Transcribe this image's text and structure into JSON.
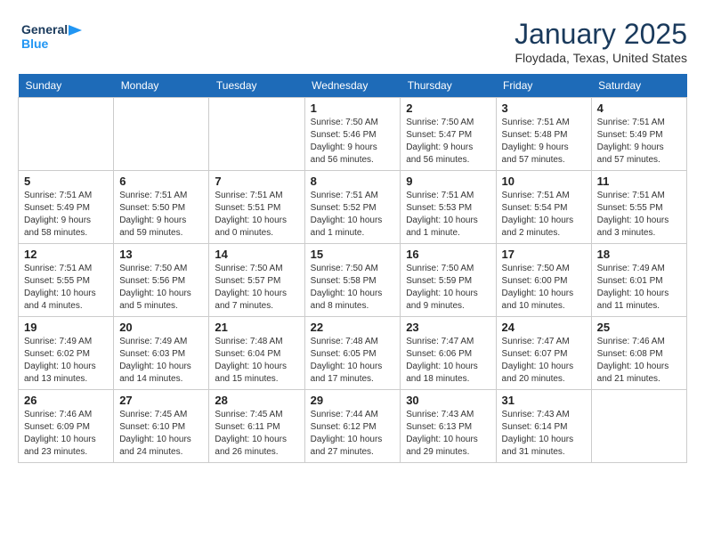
{
  "header": {
    "logo_line1": "General",
    "logo_line2": "Blue",
    "month": "January 2025",
    "location": "Floydada, Texas, United States"
  },
  "days_of_week": [
    "Sunday",
    "Monday",
    "Tuesday",
    "Wednesday",
    "Thursday",
    "Friday",
    "Saturday"
  ],
  "weeks": [
    [
      {
        "day": "",
        "info": ""
      },
      {
        "day": "",
        "info": ""
      },
      {
        "day": "",
        "info": ""
      },
      {
        "day": "1",
        "info": "Sunrise: 7:50 AM\nSunset: 5:46 PM\nDaylight: 9 hours\nand 56 minutes."
      },
      {
        "day": "2",
        "info": "Sunrise: 7:50 AM\nSunset: 5:47 PM\nDaylight: 9 hours\nand 56 minutes."
      },
      {
        "day": "3",
        "info": "Sunrise: 7:51 AM\nSunset: 5:48 PM\nDaylight: 9 hours\nand 57 minutes."
      },
      {
        "day": "4",
        "info": "Sunrise: 7:51 AM\nSunset: 5:49 PM\nDaylight: 9 hours\nand 57 minutes."
      }
    ],
    [
      {
        "day": "5",
        "info": "Sunrise: 7:51 AM\nSunset: 5:49 PM\nDaylight: 9 hours\nand 58 minutes."
      },
      {
        "day": "6",
        "info": "Sunrise: 7:51 AM\nSunset: 5:50 PM\nDaylight: 9 hours\nand 59 minutes."
      },
      {
        "day": "7",
        "info": "Sunrise: 7:51 AM\nSunset: 5:51 PM\nDaylight: 10 hours\nand 0 minutes."
      },
      {
        "day": "8",
        "info": "Sunrise: 7:51 AM\nSunset: 5:52 PM\nDaylight: 10 hours\nand 1 minute."
      },
      {
        "day": "9",
        "info": "Sunrise: 7:51 AM\nSunset: 5:53 PM\nDaylight: 10 hours\nand 1 minute."
      },
      {
        "day": "10",
        "info": "Sunrise: 7:51 AM\nSunset: 5:54 PM\nDaylight: 10 hours\nand 2 minutes."
      },
      {
        "day": "11",
        "info": "Sunrise: 7:51 AM\nSunset: 5:55 PM\nDaylight: 10 hours\nand 3 minutes."
      }
    ],
    [
      {
        "day": "12",
        "info": "Sunrise: 7:51 AM\nSunset: 5:55 PM\nDaylight: 10 hours\nand 4 minutes."
      },
      {
        "day": "13",
        "info": "Sunrise: 7:50 AM\nSunset: 5:56 PM\nDaylight: 10 hours\nand 5 minutes."
      },
      {
        "day": "14",
        "info": "Sunrise: 7:50 AM\nSunset: 5:57 PM\nDaylight: 10 hours\nand 7 minutes."
      },
      {
        "day": "15",
        "info": "Sunrise: 7:50 AM\nSunset: 5:58 PM\nDaylight: 10 hours\nand 8 minutes."
      },
      {
        "day": "16",
        "info": "Sunrise: 7:50 AM\nSunset: 5:59 PM\nDaylight: 10 hours\nand 9 minutes."
      },
      {
        "day": "17",
        "info": "Sunrise: 7:50 AM\nSunset: 6:00 PM\nDaylight: 10 hours\nand 10 minutes."
      },
      {
        "day": "18",
        "info": "Sunrise: 7:49 AM\nSunset: 6:01 PM\nDaylight: 10 hours\nand 11 minutes."
      }
    ],
    [
      {
        "day": "19",
        "info": "Sunrise: 7:49 AM\nSunset: 6:02 PM\nDaylight: 10 hours\nand 13 minutes."
      },
      {
        "day": "20",
        "info": "Sunrise: 7:49 AM\nSunset: 6:03 PM\nDaylight: 10 hours\nand 14 minutes."
      },
      {
        "day": "21",
        "info": "Sunrise: 7:48 AM\nSunset: 6:04 PM\nDaylight: 10 hours\nand 15 minutes."
      },
      {
        "day": "22",
        "info": "Sunrise: 7:48 AM\nSunset: 6:05 PM\nDaylight: 10 hours\nand 17 minutes."
      },
      {
        "day": "23",
        "info": "Sunrise: 7:47 AM\nSunset: 6:06 PM\nDaylight: 10 hours\nand 18 minutes."
      },
      {
        "day": "24",
        "info": "Sunrise: 7:47 AM\nSunset: 6:07 PM\nDaylight: 10 hours\nand 20 minutes."
      },
      {
        "day": "25",
        "info": "Sunrise: 7:46 AM\nSunset: 6:08 PM\nDaylight: 10 hours\nand 21 minutes."
      }
    ],
    [
      {
        "day": "26",
        "info": "Sunrise: 7:46 AM\nSunset: 6:09 PM\nDaylight: 10 hours\nand 23 minutes."
      },
      {
        "day": "27",
        "info": "Sunrise: 7:45 AM\nSunset: 6:10 PM\nDaylight: 10 hours\nand 24 minutes."
      },
      {
        "day": "28",
        "info": "Sunrise: 7:45 AM\nSunset: 6:11 PM\nDaylight: 10 hours\nand 26 minutes."
      },
      {
        "day": "29",
        "info": "Sunrise: 7:44 AM\nSunset: 6:12 PM\nDaylight: 10 hours\nand 27 minutes."
      },
      {
        "day": "30",
        "info": "Sunrise: 7:43 AM\nSunset: 6:13 PM\nDaylight: 10 hours\nand 29 minutes."
      },
      {
        "day": "31",
        "info": "Sunrise: 7:43 AM\nSunset: 6:14 PM\nDaylight: 10 hours\nand 31 minutes."
      },
      {
        "day": "",
        "info": ""
      }
    ]
  ]
}
